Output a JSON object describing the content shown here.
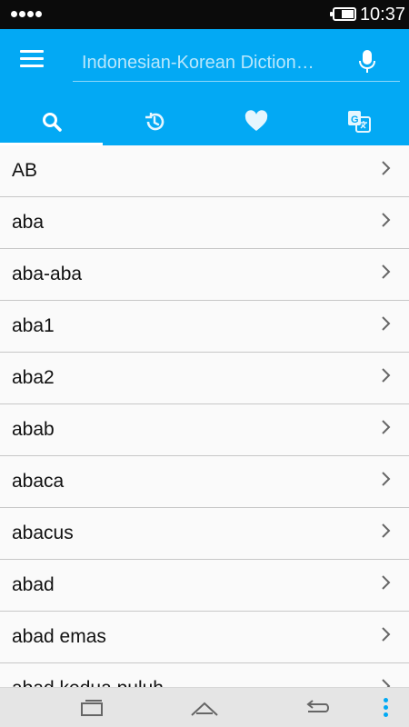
{
  "status_bar": {
    "time": "10:37",
    "signal_dots": 4
  },
  "toolbar": {
    "background": "#03a9f4",
    "search": {
      "value": "",
      "placeholder": "Indonesian-Korean Diction…"
    }
  },
  "tabs": [
    {
      "icon": "search-icon",
      "active": true
    },
    {
      "icon": "history-icon",
      "active": false
    },
    {
      "icon": "heart-icon",
      "active": false
    },
    {
      "icon": "translate-icon",
      "active": false
    }
  ],
  "word_list": {
    "items": [
      {
        "label": "AB"
      },
      {
        "label": "aba"
      },
      {
        "label": "aba-aba"
      },
      {
        "label": "aba1"
      },
      {
        "label": "aba2"
      },
      {
        "label": "abab"
      },
      {
        "label": "abaca"
      },
      {
        "label": "abacus"
      },
      {
        "label": "abad"
      },
      {
        "label": "abad emas"
      },
      {
        "label": "abad kedua puluh"
      }
    ]
  },
  "navigation_bar": {
    "icons": [
      "recent-apps-icon",
      "home-icon",
      "back-icon",
      "more-options-icon"
    ],
    "accent": "#00a9f4"
  }
}
